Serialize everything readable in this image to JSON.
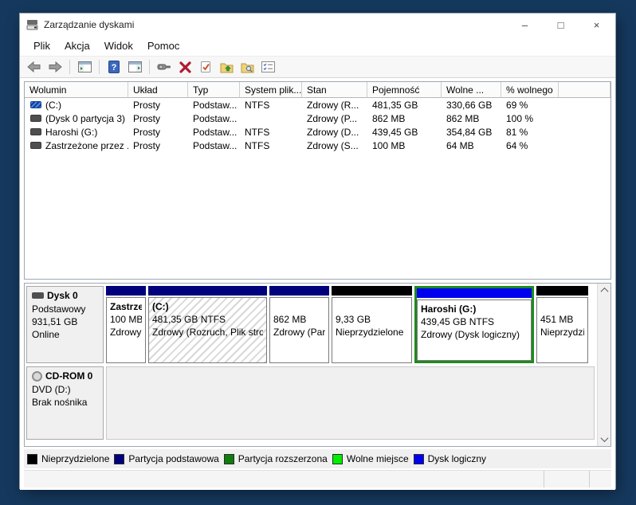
{
  "window": {
    "title": "Zarządzanie dyskami",
    "controls": {
      "minimize": "–",
      "maximize": "□",
      "close": "×"
    }
  },
  "menu": {
    "items": [
      "Plik",
      "Akcja",
      "Widok",
      "Pomoc"
    ]
  },
  "toolbar": {
    "icons": [
      "back",
      "forward",
      "show-console-tree",
      "help",
      "show-action-pane",
      "device",
      "delete-volume",
      "mark-partition-active",
      "open-folder",
      "explore",
      "properties-list"
    ]
  },
  "volume_list": {
    "columns": [
      "Wolumin",
      "Układ",
      "Typ",
      "System plik...",
      "Stan",
      "Pojemność",
      "Wolne ...",
      "% wolnego"
    ],
    "rows": [
      {
        "wolumin": "(C:)",
        "uklad": "Prosty",
        "typ": "Podstaw...",
        "system": "NTFS",
        "stan": "Zdrowy (R...",
        "pojemnosc": "481,35 GB",
        "wolne": "330,66 GB",
        "procent": "69 %"
      },
      {
        "wolumin": "(Dysk 0 partycja 3)",
        "uklad": "Prosty",
        "typ": "Podstaw...",
        "system": "",
        "stan": "Zdrowy (P...",
        "pojemnosc": "862 MB",
        "wolne": "862 MB",
        "procent": "100 %"
      },
      {
        "wolumin": "Haroshi (G:)",
        "uklad": "Prosty",
        "typ": "Podstaw...",
        "system": "NTFS",
        "stan": "Zdrowy (D...",
        "pojemnosc": "439,45 GB",
        "wolne": "354,84 GB",
        "procent": "81 %"
      },
      {
        "wolumin": "Zastrzeżone przez ...",
        "uklad": "Prosty",
        "typ": "Podstaw...",
        "system": "NTFS",
        "stan": "Zdrowy (S...",
        "pojemnosc": "100 MB",
        "wolne": "64 MB",
        "procent": "64 %"
      }
    ]
  },
  "disks": [
    {
      "label": {
        "name": "Dysk 0",
        "type": "Podstawowy",
        "size": "931,51 GB",
        "status": "Online"
      },
      "partitions": [
        {
          "title": "Zastrze",
          "line2": "100 MB",
          "line3": "Zdrowy",
          "band": "primary"
        },
        {
          "title": "(C:)",
          "line2": "481,35 GB NTFS",
          "line3": "Zdrowy (Rozruch, Plik stro",
          "band": "primary",
          "hatched": true
        },
        {
          "title": "",
          "line2": "862 MB",
          "line3": "Zdrowy (Par",
          "band": "primary"
        },
        {
          "title": "",
          "line2": "9,33 GB",
          "line3": "Nieprzydzielone",
          "band": "unallocated"
        },
        {
          "title": "Haroshi  (G:)",
          "line2": "439,45 GB NTFS",
          "line3": "Zdrowy (Dysk logiczny)",
          "band": "logical",
          "extended_selection": true
        },
        {
          "title": "",
          "line2": "451 MB",
          "line3": "Nieprzydzie",
          "band": "unallocated"
        }
      ]
    },
    {
      "label": {
        "name": "CD-ROM 0",
        "type": "DVD (D:)",
        "size": "",
        "status": "Brak nośnika"
      },
      "partitions": []
    }
  ],
  "legend": {
    "items": [
      {
        "label": "Nieprzydzielone",
        "color": "#000000"
      },
      {
        "label": "Partycja podstawowa",
        "color": "#00007c"
      },
      {
        "label": "Partycja rozszerzona",
        "color": "#0e7c0e"
      },
      {
        "label": "Wolne miejsce",
        "color": "#00ee00"
      },
      {
        "label": "Dysk logiczny",
        "color": "#0000f0"
      }
    ]
  },
  "status_bar": {
    "sections": [
      "",
      "",
      ""
    ]
  },
  "colors": {
    "desktop_background": "#15395e",
    "primary_partition": "#00007c",
    "logical_drive": "#0000f0",
    "unallocated": "#000000",
    "free_space": "#00ee00",
    "extended_partition": "#0e7c0e",
    "extended_selection_border": "#1e8a1e"
  }
}
